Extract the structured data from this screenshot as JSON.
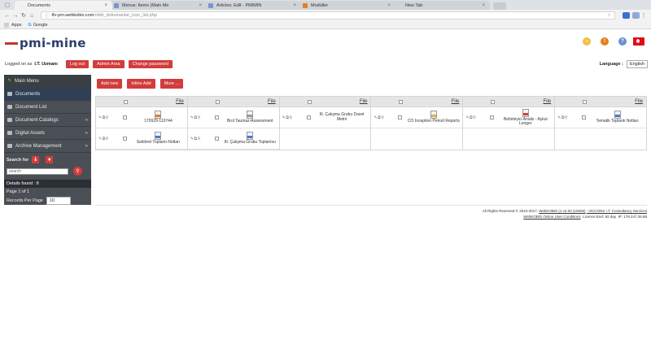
{
  "browser": {
    "tabs": [
      {
        "title": "Documents",
        "active": true,
        "color": "#f0f0f0"
      },
      {
        "title": "Menus: Items (Main Me",
        "active": false,
        "color": "#7b95c9"
      },
      {
        "title": "Articles: Edit - PMIMIN",
        "active": false,
        "color": "#7b95c9"
      },
      {
        "title": "Modüller",
        "active": false,
        "color": "#e67e22"
      },
      {
        "title": "New Tab",
        "active": false,
        "color": "#d0d3d8"
      }
    ],
    "url_host": "tfv-pm.webkobis.com",
    "url_path": "/mbb_dokumanlar_icon_list.php",
    "bookmarks": [
      "Apps",
      "Google"
    ]
  },
  "header": {
    "logo_text": "pmi-mine",
    "logged_on_as": "Logged on as",
    "user": "I.T. Uzmanı",
    "buttons": [
      "Log out",
      "Admin Area",
      "Change password"
    ],
    "language_label": "Language :",
    "language_value": "English"
  },
  "sidebar": {
    "items": [
      {
        "label": "Main Menu",
        "arrow": ""
      },
      {
        "label": "Documents",
        "arrow": ""
      },
      {
        "label": "Document List",
        "arrow": ""
      },
      {
        "label": "Document Catalogs",
        "arrow": "»"
      },
      {
        "label": "Digital Assets",
        "arrow": "»"
      },
      {
        "label": "Archive Management",
        "arrow": "»"
      }
    ],
    "search_for": "Search for",
    "search_placeholder": "search",
    "details_found": "Details found : 8",
    "page_of": "Page 1 of 1",
    "records_per_page_label": "Records Per Page",
    "records_per_page_value": "10"
  },
  "actions": [
    "Add new",
    "Inline Add",
    "More ..."
  ],
  "grid": {
    "header_label": "File",
    "columns": [
      {
        "docs": [
          {
            "name": "170929-110744",
            "type": "doc-orange"
          },
          {
            "name": "Sektörel Toplantı Notları",
            "type": "doc-blue"
          }
        ]
      },
      {
        "docs": [
          {
            "name": "Brol Taumaz-Assessment",
            "type": "doc-gray"
          },
          {
            "name": "III. Çalışma Grubu Toplantısı",
            "type": "doc-blue"
          }
        ]
      },
      {
        "docs": [
          {
            "name": "III. Çalışma Grubu Davet Metni",
            "type": "none"
          }
        ]
      },
      {
        "docs": [
          {
            "name": "CO Inception Period Reports",
            "type": "doc-yellow"
          }
        ]
      },
      {
        "docs": [
          {
            "name": "Bebirleyici Analiz - Aykul Lenger",
            "type": "doc-red"
          }
        ]
      },
      {
        "docs": [
          {
            "name": "Tematik Toplantı Notları",
            "type": "doc-blue"
          }
        ]
      }
    ]
  },
  "footer": {
    "line1a": "All Rights Reserved © 2010-2017,",
    "line1b": "WebKOBIS (1 v2.00 (15506)",
    "line1c": "- OCCONS I.T. Consultancy Services",
    "line2a": "WebKOBIS Online User Conditions",
    "line2b": "Licence End: 92 day",
    "line2c": "IP: 178.247.26.88"
  }
}
